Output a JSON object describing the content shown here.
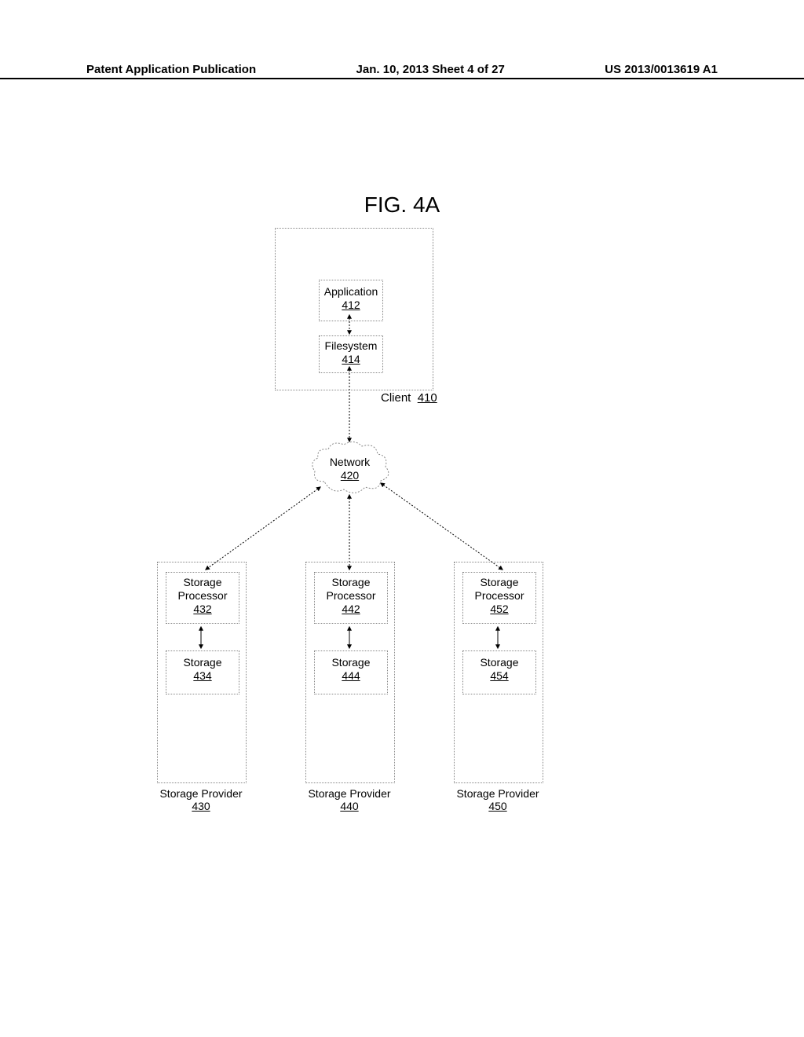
{
  "header": {
    "left": "Patent Application Publication",
    "center": "Jan. 10, 2013  Sheet 4 of 27",
    "right": "US 2013/0013619 A1"
  },
  "figure_title": "FIG. 4A",
  "client": {
    "label": "Client",
    "ref": "410",
    "application": {
      "label": "Application",
      "ref": "412"
    },
    "filesystem": {
      "label": "Filesystem",
      "ref": "414"
    }
  },
  "network": {
    "label": "Network",
    "ref": "420"
  },
  "providers": [
    {
      "label": "Storage Provider",
      "ref": "430",
      "processor": {
        "label": "Storage Processor",
        "ref": "432"
      },
      "storage": {
        "label": "Storage",
        "ref": "434"
      }
    },
    {
      "label": "Storage Provider",
      "ref": "440",
      "processor": {
        "label": "Storage Processor",
        "ref": "442"
      },
      "storage": {
        "label": "Storage",
        "ref": "444"
      }
    },
    {
      "label": "Storage Provider",
      "ref": "450",
      "processor": {
        "label": "Storage Processor",
        "ref": "452"
      },
      "storage": {
        "label": "Storage",
        "ref": "454"
      }
    }
  ]
}
